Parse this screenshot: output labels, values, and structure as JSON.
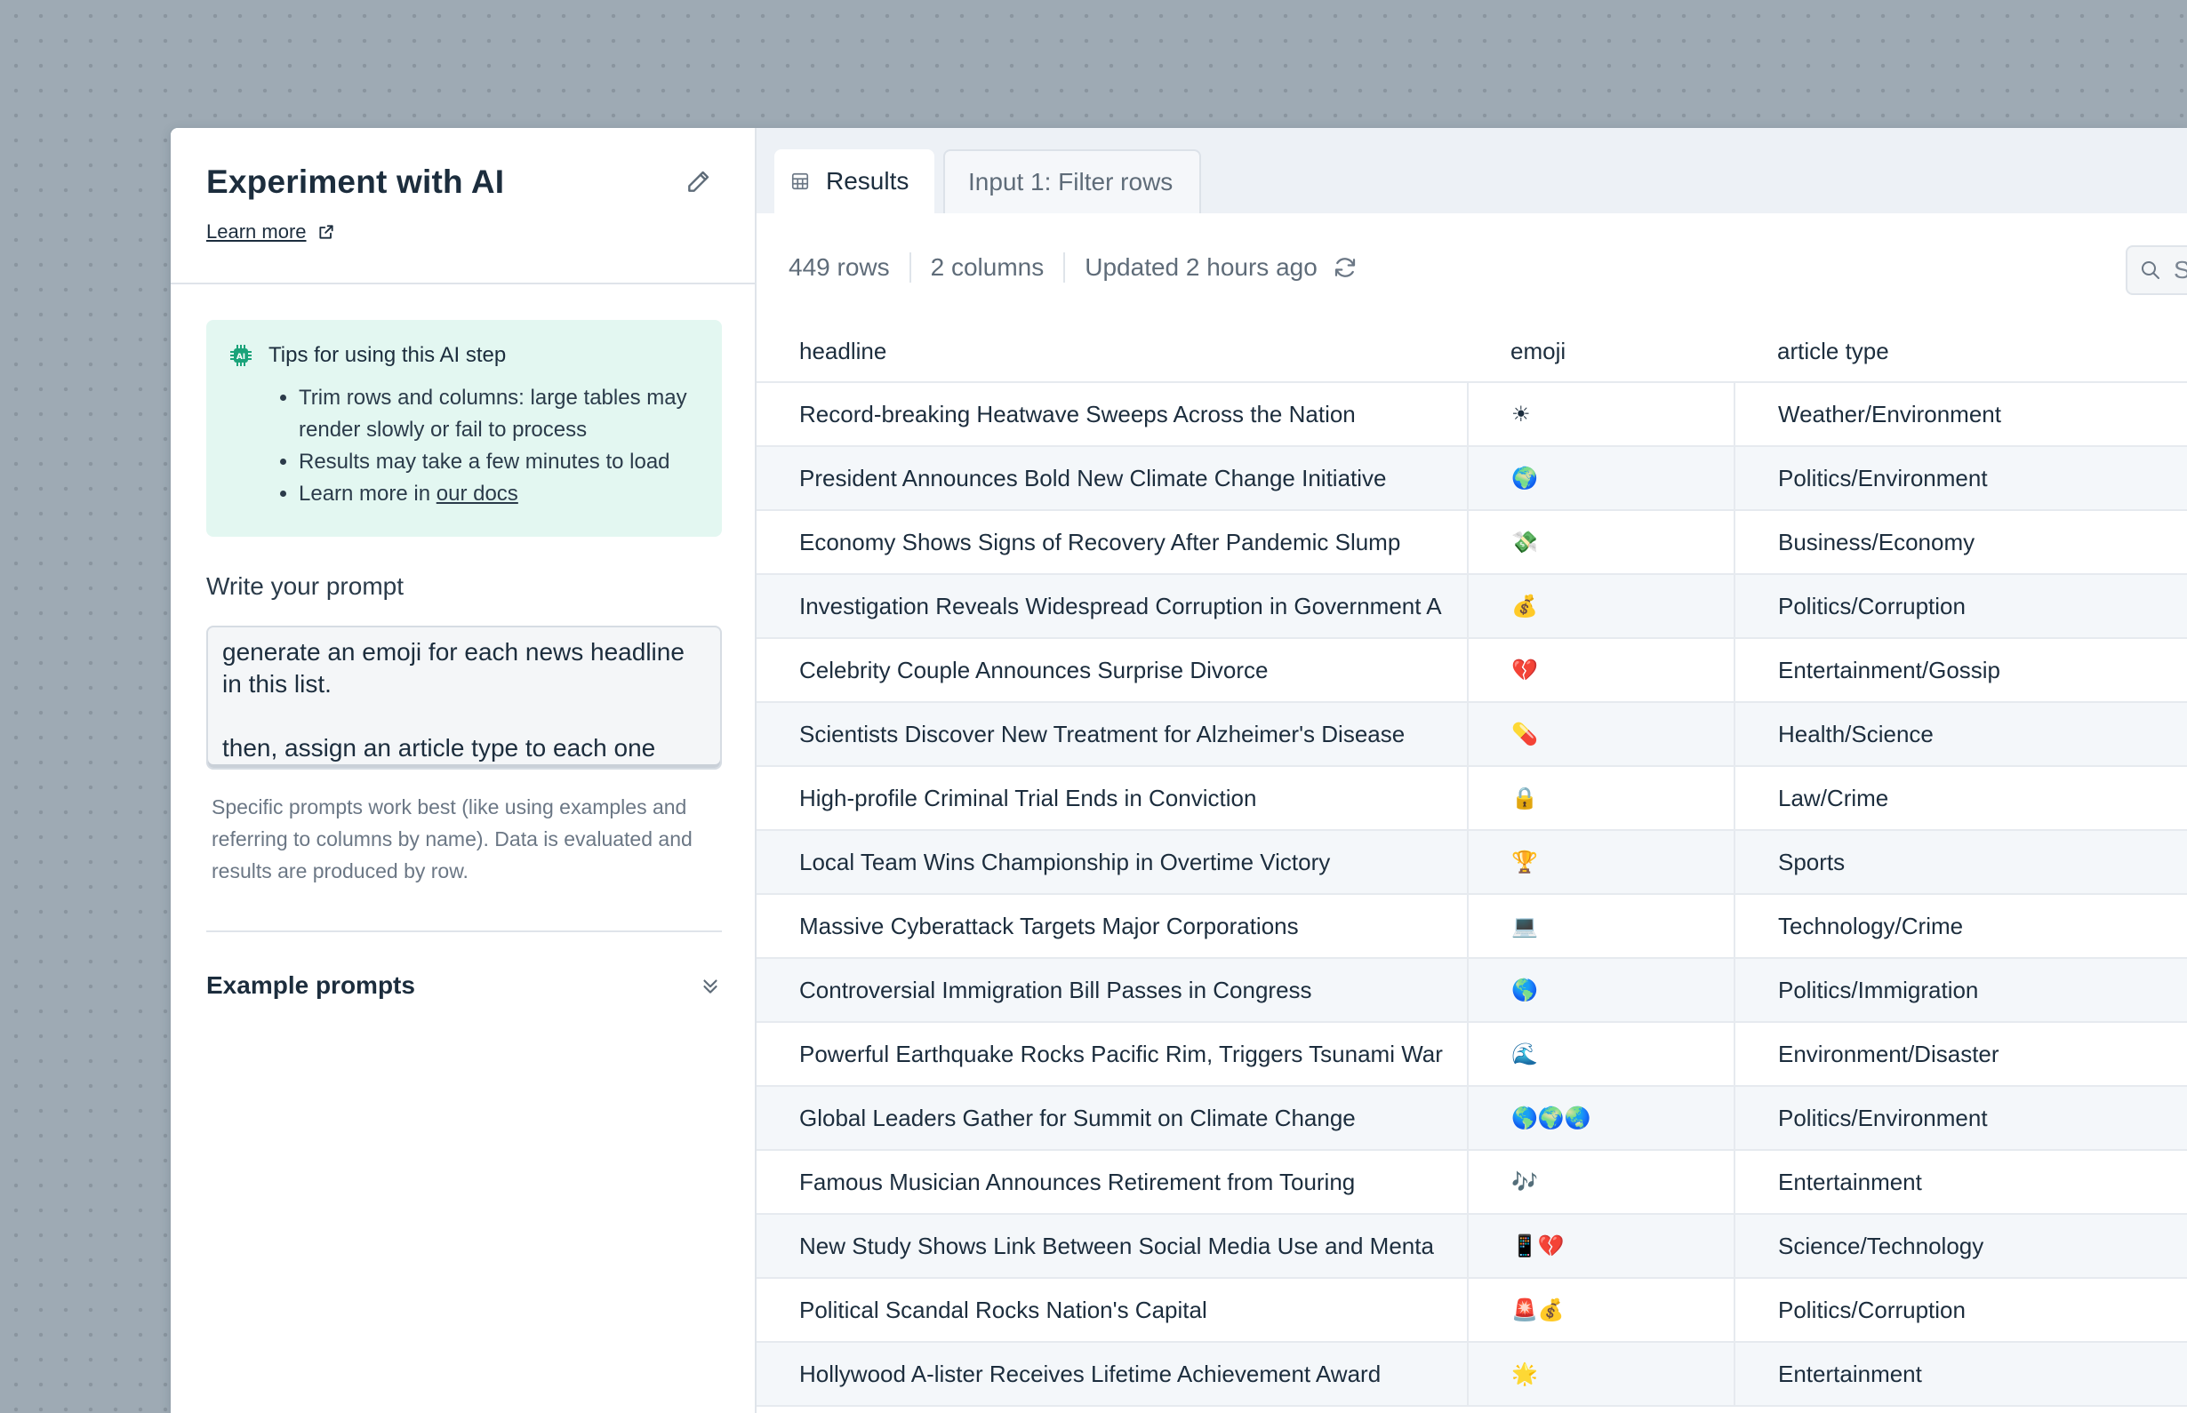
{
  "panel": {
    "title": "Experiment with AI",
    "learn_more": "Learn more",
    "tips": {
      "heading": "Tips for using this AI step",
      "items": [
        "Trim rows and columns: large tables may render slowly or fail to process",
        "Results may take a few minutes to load"
      ],
      "docs_prefix": "Learn more in ",
      "docs_link": "our docs"
    },
    "prompt_label": "Write your prompt",
    "prompt_value": "generate an emoji for each news headline in this list.\n\nthen, assign an article type to each one",
    "helper_text": "Specific prompts work best (like using examples and referring to columns by name). Data is evaluated and results are produced by row.",
    "examples_label": "Example prompts"
  },
  "tabs": [
    {
      "label": "Results",
      "active": true
    },
    {
      "label": "Input 1: Filter rows",
      "active": false
    }
  ],
  "info": {
    "rows": "449 rows",
    "columns": "2 columns",
    "updated": "Updated 2 hours ago"
  },
  "search": {
    "placeholder": "Search ..."
  },
  "table": {
    "headers": [
      "headline",
      "emoji",
      "article type"
    ],
    "rows": [
      [
        "Record-breaking Heatwave Sweeps Across the Nation",
        "☀",
        "Weather/Environment"
      ],
      [
        "President Announces Bold New Climate Change Initiative",
        "🌍",
        "Politics/Environment"
      ],
      [
        "Economy Shows Signs of Recovery After Pandemic Slump",
        "💸",
        "Business/Economy"
      ],
      [
        "Investigation Reveals Widespread Corruption in Government A",
        "💰",
        "Politics/Corruption"
      ],
      [
        "Celebrity Couple Announces Surprise Divorce",
        "💔",
        "Entertainment/Gossip"
      ],
      [
        "Scientists Discover New Treatment for Alzheimer's Disease",
        "💊",
        "Health/Science"
      ],
      [
        "High-profile Criminal Trial Ends in Conviction",
        "🔒",
        "Law/Crime"
      ],
      [
        "Local Team Wins Championship in Overtime Victory",
        "🏆",
        "Sports"
      ],
      [
        "Massive Cyberattack Targets Major Corporations",
        "💻",
        "Technology/Crime"
      ],
      [
        "Controversial Immigration Bill Passes in Congress",
        "🌎",
        "Politics/Immigration"
      ],
      [
        "Powerful Earthquake Rocks Pacific Rim, Triggers Tsunami War",
        "🌊",
        "Environment/Disaster"
      ],
      [
        "Global Leaders Gather for Summit on Climate Change",
        "🌎🌍🌏",
        "Politics/Environment"
      ],
      [
        "Famous Musician Announces Retirement from Touring",
        "🎶",
        "Entertainment"
      ],
      [
        "New Study Shows Link Between Social Media Use and Menta",
        "📱💔",
        "Science/Technology"
      ],
      [
        "Political Scandal Rocks Nation's Capital",
        "🚨💰",
        "Politics/Corruption"
      ],
      [
        "Hollywood A-lister Receives Lifetime Achievement Award",
        "🌟",
        "Entertainment"
      ]
    ]
  },
  "colors": {
    "accent": "#1ba37a",
    "tips_bg": "#e3f7f1",
    "stripe": "#f4f7fa"
  },
  "icons": [
    "pencil-icon",
    "external-link-icon",
    "ai-chip-icon",
    "chevron-double-down-icon",
    "table-icon",
    "undo-icon",
    "redo-icon",
    "refresh-icon",
    "search-icon"
  ]
}
